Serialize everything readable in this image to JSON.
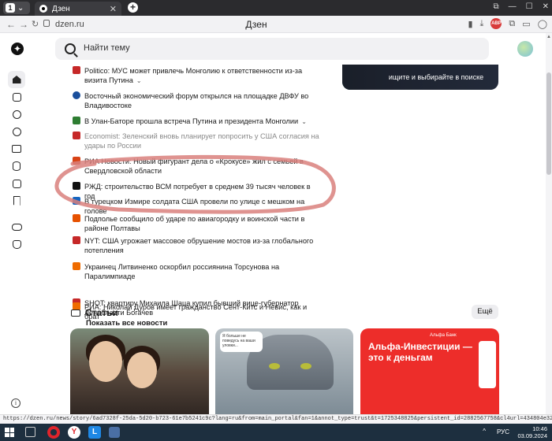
{
  "browser": {
    "tab_count": "1",
    "tab_title": "Дзен",
    "tab_close": "✕",
    "new_tab": "+",
    "window_controls": [
      "⧉",
      "—",
      "☐",
      "✕"
    ],
    "domain": "dzen.ru",
    "page_title": "Дзен",
    "back": "←",
    "forward": "→",
    "reload": "↻",
    "right_icons": [
      "bookmark-icon",
      "download-icon",
      "adblock-icon",
      "extensions-icon",
      "sidebar-icon",
      "profile-icon"
    ],
    "abp_label": "ABP"
  },
  "header": {
    "search_placeholder": "Найти тему"
  },
  "promo": {
    "text": "ищите и выбирайте в поиске"
  },
  "sidebar": {
    "items": [
      {
        "name": "home",
        "icon": "home-icon",
        "active": true
      },
      {
        "name": "subscriptions",
        "icon": "check-box-icon"
      },
      {
        "name": "search",
        "icon": "search-circle-icon"
      },
      {
        "name": "clips",
        "icon": "play-icon"
      },
      {
        "name": "reading",
        "icon": "book-icon"
      },
      {
        "name": "storage",
        "icon": "database-icon"
      },
      {
        "name": "studio",
        "icon": "studio-icon"
      },
      {
        "name": "bookmarks",
        "icon": "bookmark-icon"
      },
      {
        "name": "games",
        "icon": "gamepad-icon"
      },
      {
        "name": "kids",
        "icon": "cat-icon"
      }
    ],
    "info": "i"
  },
  "news": [
    {
      "source_color": "#c62828",
      "text": "Politico: МУС может привлечь Монголию к ответственности из-за визита Путина",
      "chevron": true
    },
    {
      "source_color": "#1a4f9c",
      "text": "Восточный экономический форум открылся на площадке ДВФУ во Владивостоке"
    },
    {
      "source_color": "#2e7d32",
      "text": "В Улан-Баторе прошла встреча Путина и президента Монголии",
      "chevron": true
    },
    {
      "source_color": "#c62828",
      "text": "Economist: Зеленский вновь планирует попросить у США согласия на удары по России",
      "faded": true
    },
    {
      "source_color": "#d84315",
      "text": "РИА Новости: Новый фигурант дела о «Крокусе» жил с семьей в Свердловской области"
    },
    {
      "source_color": "#111111",
      "text": "РЖД: строительство ВСМ потребует в среднем 39 тысяч человек в год"
    },
    {
      "source_color": "#1565c0",
      "text": "В турецком Измире солдата США провели по улице с мешком на голове"
    },
    {
      "source_color": "#e65100",
      "text": "Подполье сообщило об ударе по авиагородку и воинской части в районе Полтавы"
    },
    {
      "source_color": "#c62828",
      "text": "NYT: США угрожает массовое обрушение мостов из-за глобального потепления"
    },
    {
      "source_color": "#ef6c00",
      "text": "Украинец Литвиненко оскорбил россиянина Торсунова на Паралимпиаде"
    },
    {
      "source_color": "#c62828",
      "text": "SHOT: квартиру Михаила Шаца купил бывший вице-губернатор Ленобласти Богачев"
    },
    {
      "source_color": "#ef6c00",
      "text": "РИА: Николай Дуров имеет гражданство Сент-Китс и Невис, как и брат"
    }
  ],
  "show_all": "Показать все новости",
  "articles": {
    "title": "Статьи",
    "more": "Ещё"
  },
  "cards": {
    "card2_bubble": "Я больше не поведусь на ваши уловки...",
    "card3_brand": "Альфа Банк",
    "card3_title": "Альфа-Инвестиции — это к деньгам"
  },
  "status_url": "https://dzen.ru/news/story/6ad7328f-25da-5d20-b723-61e7b5241c9c?lang=ru&from=main_portal&fan=1&annot_type=trust&t=1725348825&persistent_id=2882567758&cl4url=434804e32c0a1cd3f4556ffed221609c&story=17253495...",
  "taskbar": {
    "lang": "РУС",
    "time": "10:46",
    "date": "03.09.2024",
    "tray_arrow": "^"
  },
  "colors": {
    "annotation": "#d9807d",
    "accent_red": "#ed2d2a"
  }
}
